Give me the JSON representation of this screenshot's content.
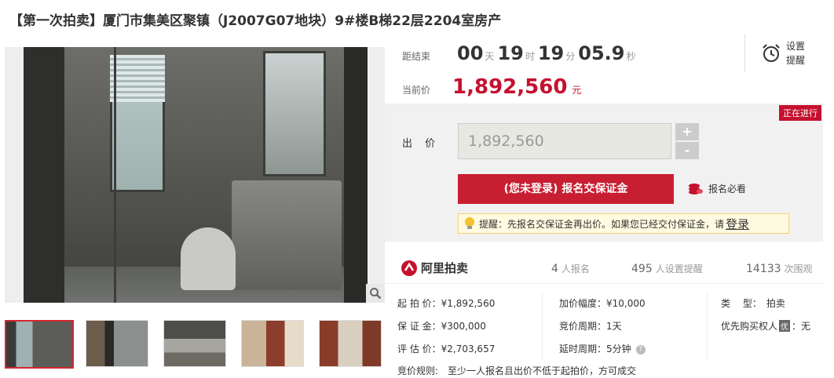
{
  "title": "【第一次拍卖】厦门市集美区聚镇（J2007G07地块）9#楼B梯22层2204室房产",
  "countdown": {
    "label": "距结束",
    "days": "00",
    "days_unit": "天",
    "hours": "19",
    "hours_unit": "时",
    "minutes": "19",
    "minutes_unit": "分",
    "seconds": "05.9",
    "seconds_unit": "秒"
  },
  "remind": {
    "label": "设置提醒",
    "icon": "alarm-clock-icon"
  },
  "current_price": {
    "label": "当前价",
    "value": "1,892,560",
    "unit": "元"
  },
  "bid": {
    "status": "正在进行",
    "label": "出 价",
    "input_value": "1,892,560",
    "plus": "+",
    "minus": "-",
    "signup_button": "(您未登录) 报名交保证金",
    "must_read": "报名必看",
    "notice_prefix": "提醒：先报名交保证金再出价。如果您已经交付保证金，请",
    "notice_link": "登录"
  },
  "stats": {
    "brand": "阿里拍卖",
    "signups_n": "4",
    "signups_label": "人报名",
    "reminders_n": "495",
    "reminders_label": "人设置提醒",
    "watchers_n": "14133",
    "watchers_label": "次围观"
  },
  "info": {
    "start_price": "起 拍 价：¥1,892,560",
    "deposit": "保 证 金：¥300,000",
    "appraisal": "评 估 价：¥2,703,657",
    "increment": "加价幅度：¥10,000",
    "cycle": "竞价周期：1天",
    "extension": "延时周期：5分钟",
    "type_label": "类　 型：",
    "type_value": "拍卖",
    "priority_label": "优先购买权人",
    "priority_tag": "优",
    "priority_value": "：无",
    "rules": "竞价规则:　至少一人报名且出价不低于起拍价，方可成交"
  },
  "colors": {
    "accent": "#c6102f",
    "button": "#c81e31"
  }
}
